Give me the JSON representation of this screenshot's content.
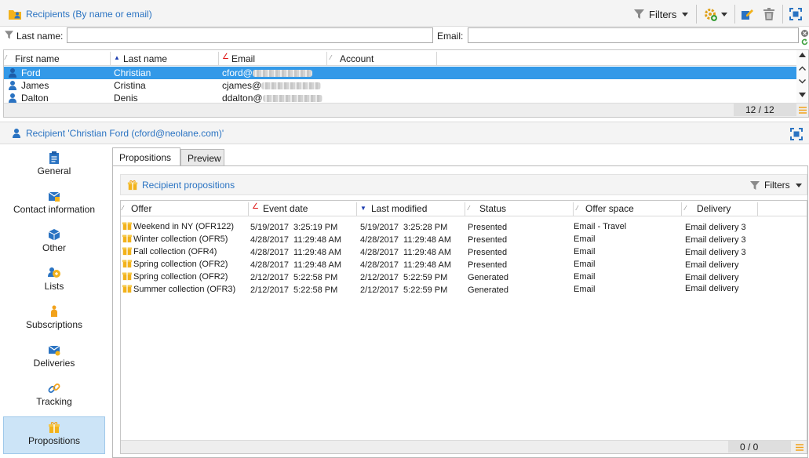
{
  "top_panel": {
    "title": "Recipients (By name or email)",
    "filters_label": "Filters"
  },
  "filter_bar": {
    "last_name_label": "Last name:",
    "last_name_value": "",
    "email_label": "Email:",
    "email_value": ""
  },
  "recipients_grid": {
    "columns": [
      "First name",
      "Last name",
      "Email",
      "Account"
    ],
    "rows": [
      {
        "first_name": "Ford",
        "last_name": "Christian",
        "email": "cford@"
      },
      {
        "first_name": "James",
        "last_name": "Cristina",
        "email": "cjames@"
      },
      {
        "first_name": "Dalton",
        "last_name": "Denis",
        "email": "ddalton@"
      }
    ],
    "count": "12 / 12"
  },
  "detail": {
    "title": "Recipient 'Christian Ford (cford@neolane.com)'"
  },
  "nav": {
    "items": [
      {
        "label": "General"
      },
      {
        "label": "Contact information"
      },
      {
        "label": "Other"
      },
      {
        "label": "Lists"
      },
      {
        "label": "Subscriptions"
      },
      {
        "label": "Deliveries"
      },
      {
        "label": "Tracking"
      },
      {
        "label": "Propositions"
      }
    ]
  },
  "tabs": {
    "propositions": "Propositions",
    "preview": "Preview"
  },
  "propositions": {
    "title": "Recipient propositions",
    "filters_label": "Filters",
    "columns": [
      "Offer",
      "Event date",
      "Last modified",
      "Status",
      "Offer space",
      "Delivery"
    ],
    "rows": [
      {
        "offer": "Weekend in NY (OFR122)",
        "event_date": "5/19/2017  3:25:19 PM",
        "last_modified": "5/19/2017  3:25:28 PM",
        "status": "Presented",
        "offer_space": "Email - Travel",
        "delivery": "Email delivery 3"
      },
      {
        "offer": "Winter collection (OFR5)",
        "event_date": "4/28/2017  11:29:48 AM",
        "last_modified": "4/28/2017  11:29:48 AM",
        "status": "Presented",
        "offer_space": "Email",
        "delivery": "Email delivery 3"
      },
      {
        "offer": "Fall collection (OFR4)",
        "event_date": "4/28/2017  11:29:48 AM",
        "last_modified": "4/28/2017  11:29:48 AM",
        "status": "Presented",
        "offer_space": "Email",
        "delivery": "Email delivery 3"
      },
      {
        "offer": "Spring collection (OFR2)",
        "event_date": "4/28/2017  11:29:48 AM",
        "last_modified": "4/28/2017  11:29:48 AM",
        "status": "Presented",
        "offer_space": "Email",
        "delivery": "Email delivery"
      },
      {
        "offer": "Spring collection (OFR2)",
        "event_date": "2/12/2017  5:22:58 PM",
        "last_modified": "2/12/2017  5:22:59 PM",
        "status": "Generated",
        "offer_space": "Email",
        "delivery": "Email delivery"
      },
      {
        "offer": "Summer collection (OFR3)",
        "event_date": "2/12/2017  5:22:58 PM",
        "last_modified": "2/12/2017  5:22:59 PM",
        "status": "Generated",
        "offer_space": "Email",
        "delivery": "Email delivery"
      }
    ],
    "count": "0 / 0"
  },
  "colors": {
    "accent_blue": "#2a73c2",
    "selected_row": "#3399e8",
    "nav_selected": "#cce4f7",
    "icon_gold": "#f2b21b"
  },
  "icons": [
    "folder-person-icon",
    "funnel-icon",
    "gear-add-icon",
    "edit-icon",
    "trash-icon",
    "maximize-icon",
    "person-icon",
    "gift-icon",
    "clear-icon",
    "refresh-icon",
    "menu-icon"
  ]
}
